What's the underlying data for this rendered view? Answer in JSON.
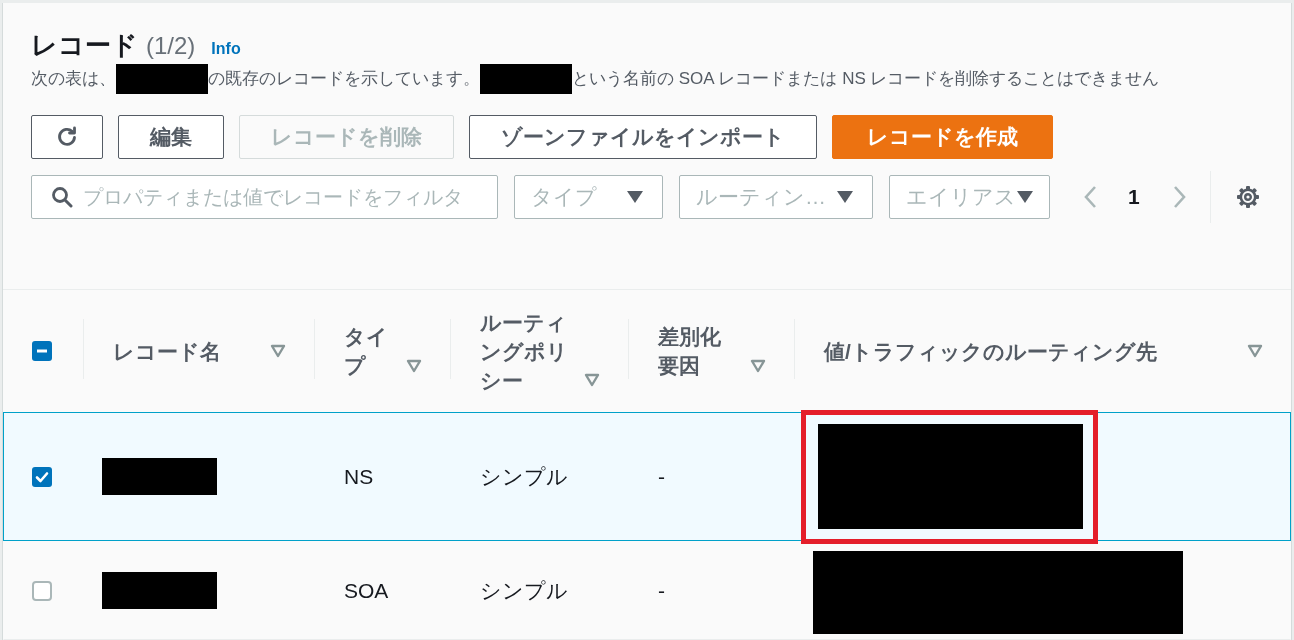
{
  "header": {
    "title": "レコード",
    "count": "(1/2)",
    "info_link": "Info"
  },
  "description": [
    {
      "kind": "text",
      "text": "次の表は、"
    },
    {
      "kind": "redacted"
    },
    {
      "kind": "text",
      "text": "の既存のレコードを示しています。"
    },
    {
      "kind": "redacted"
    },
    {
      "kind": "text",
      "text": "という名前の SOA レコードまたは NS レコードを削除することはできません"
    }
  ],
  "actions": [
    {
      "kind": "refresh",
      "disabled": false
    },
    {
      "kind": "normal",
      "label": "編集",
      "disabled": false
    },
    {
      "kind": "normal",
      "label": "レコードを削除",
      "disabled": true
    },
    {
      "kind": "normal",
      "label": "ゾーンファイルをインポート",
      "disabled": false
    },
    {
      "kind": "primary",
      "label": "レコードを作成",
      "disabled": false
    }
  ],
  "filters": {
    "search": {
      "placeholder": "プロパティまたは値でレコードをフィルタ"
    },
    "dropdowns": [
      {
        "placeholder": "タイプ"
      },
      {
        "placeholder": "ルーティン…"
      },
      {
        "placeholder": "エイリアス"
      }
    ]
  },
  "pagination": {
    "previous": {
      "disabled": true
    },
    "pages": [
      {
        "label": "1",
        "selected": true
      }
    ],
    "next": {
      "disabled": true
    }
  },
  "table": {
    "select_all": {
      "indeterminate": true
    },
    "columns": [
      {
        "label": "レコード名"
      },
      {
        "label": "タイプ"
      },
      {
        "label": "ルーティングポリシー"
      },
      {
        "label": "差別化要因"
      },
      {
        "label": "値/トラフィックのルーティング先"
      }
    ],
    "rows": [
      {
        "selected": true,
        "cells": [
          {
            "kind": "redacted",
            "highlighted": false
          },
          {
            "kind": "text",
            "text": "NS"
          },
          {
            "kind": "text",
            "text": "シンプル"
          },
          {
            "kind": "text",
            "text": "-"
          },
          {
            "kind": "redacted",
            "highlighted": true
          }
        ]
      },
      {
        "selected": false,
        "cells": [
          {
            "kind": "redacted",
            "highlighted": false
          },
          {
            "kind": "text",
            "text": "SOA"
          },
          {
            "kind": "text",
            "text": "シンプル"
          },
          {
            "kind": "text",
            "text": "-"
          },
          {
            "kind": "redacted",
            "highlighted": false
          }
        ]
      }
    ]
  }
}
